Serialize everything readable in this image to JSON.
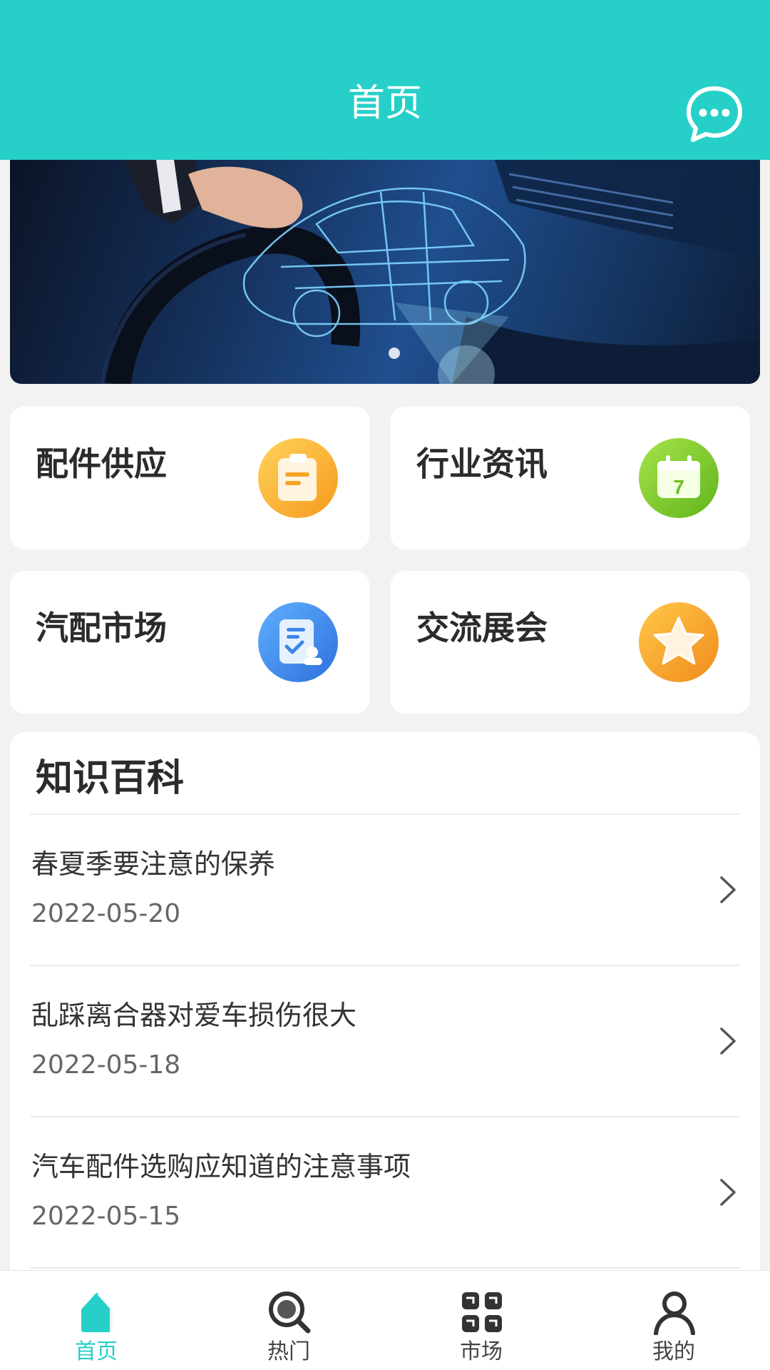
{
  "header": {
    "title": "首页",
    "message_icon": "chat-bubble-icon",
    "bg_color": "#26d0c8"
  },
  "banner": {
    "image": "car-hologram-dashboard",
    "dots": 1,
    "active_dot": 0
  },
  "categories": [
    {
      "label": "配件供应",
      "icon": "clipboard-icon",
      "color": "#f7a92b"
    },
    {
      "label": "行业资讯",
      "icon": "calendar-7-icon",
      "color": "#7cc726"
    },
    {
      "label": "汽配市场",
      "icon": "document-check-icon",
      "color": "#3d86e8"
    },
    {
      "label": "交流展会",
      "icon": "star-icon",
      "color": "#f7a92b"
    }
  ],
  "knowledge": {
    "title": "知识百科",
    "items": [
      {
        "title": "春夏季要注意的保养",
        "date": "2022-05-20"
      },
      {
        "title": "乱踩离合器对爱车损伤很大",
        "date": "2022-05-18"
      },
      {
        "title": "汽车配件选购应知道的注意事项",
        "date": "2022-05-15"
      }
    ]
  },
  "tabbar": {
    "active_color": "#26d0c8",
    "tabs": [
      {
        "label": "首页",
        "icon": "home-icon",
        "active": true
      },
      {
        "label": "热门",
        "icon": "search-icon",
        "active": false
      },
      {
        "label": "市场",
        "icon": "grid-icon",
        "active": false
      },
      {
        "label": "我的",
        "icon": "user-icon",
        "active": false
      }
    ]
  }
}
